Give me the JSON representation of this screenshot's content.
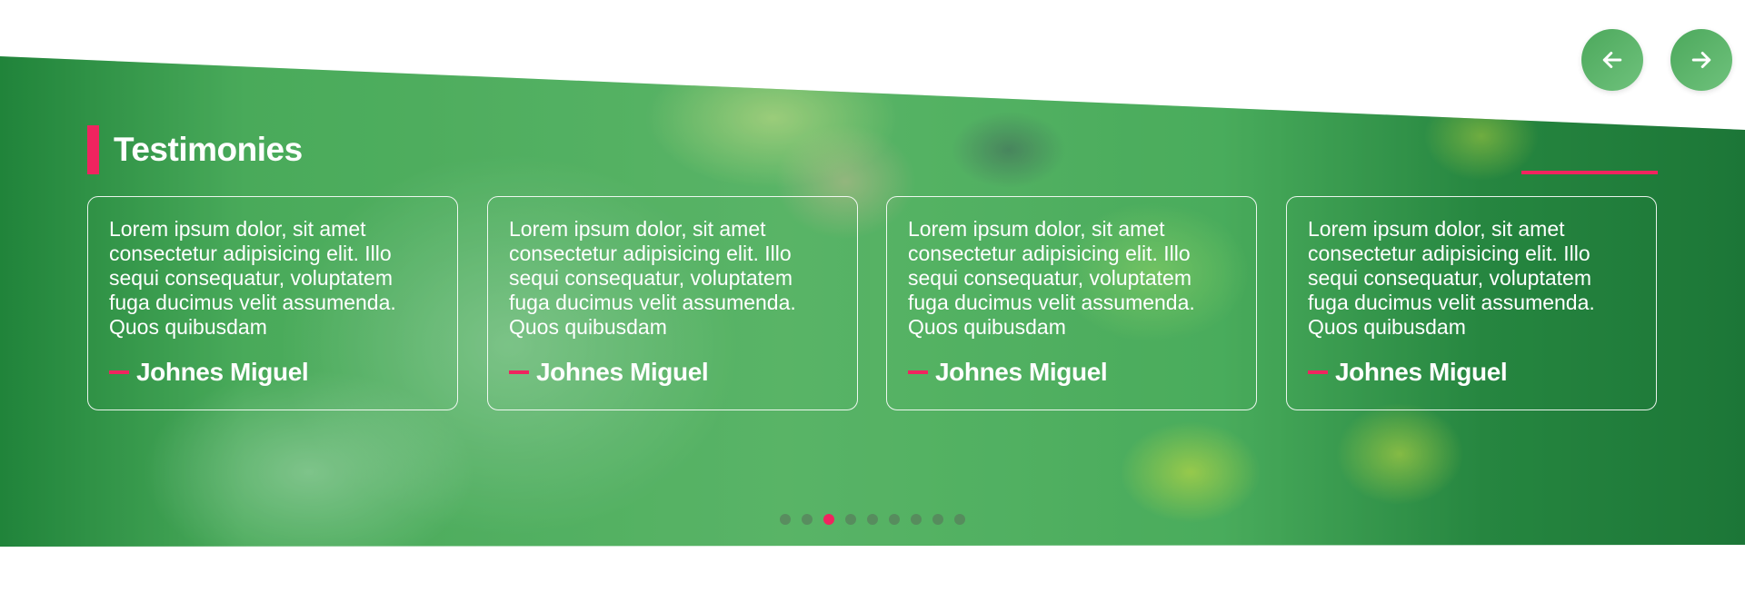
{
  "section": {
    "title": "Testimonies"
  },
  "navigation": {
    "prev_icon": "arrow-left-icon",
    "next_icon": "arrow-right-icon"
  },
  "testimonials": [
    {
      "text": "Lorem ipsum dolor, sit amet consectetur adipisicing elit. Illo sequi consequatur, voluptatem fuga ducimus velit assumenda. Quos quibusdam",
      "author": "Johnes Miguel"
    },
    {
      "text": "Lorem ipsum dolor, sit amet consectetur adipisicing elit. Illo sequi consequatur, voluptatem fuga ducimus velit assumenda. Quos quibusdam",
      "author": "Johnes Miguel"
    },
    {
      "text": "Lorem ipsum dolor, sit amet consectetur adipisicing elit. Illo sequi consequatur, voluptatem fuga ducimus velit assumenda. Quos quibusdam",
      "author": "Johnes Miguel"
    },
    {
      "text": "Lorem ipsum dolor, sit amet consectetur adipisicing elit. Illo sequi consequatur, voluptatem fuga ducimus velit assumenda. Quos quibusdam",
      "author": "Johnes Miguel"
    }
  ],
  "pagination": {
    "total": 9,
    "active_index": 2
  },
  "colors": {
    "accent": "#f0245f",
    "brand_green": "#4ca85c",
    "text": "#ffffff"
  }
}
